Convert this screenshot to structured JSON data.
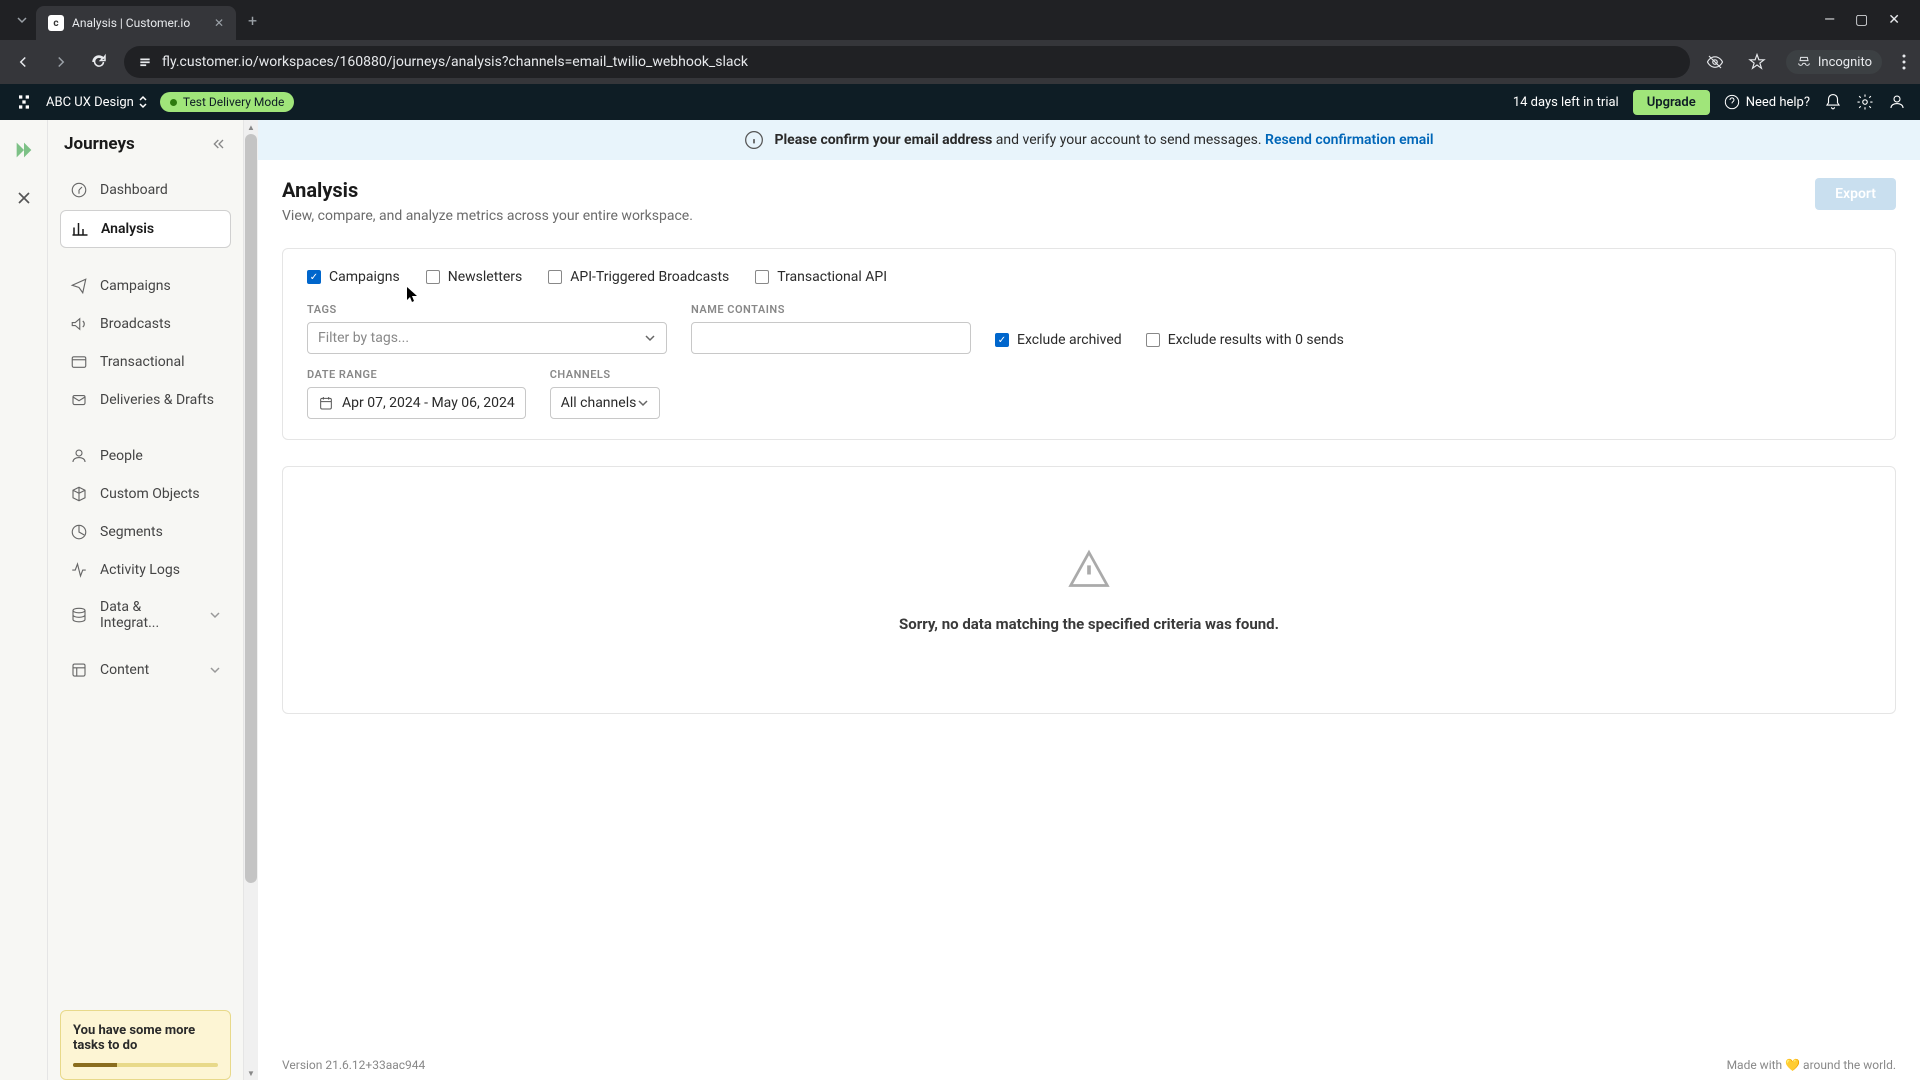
{
  "browser": {
    "tab_title": "Analysis | Customer.io",
    "url": "fly.customer.io/workspaces/160880/journeys/analysis?channels=email_twilio_webhook_slack",
    "incognito": "Incognito"
  },
  "header": {
    "workspace": "ABC UX Design",
    "delivery_mode": "Test Delivery Mode",
    "trial": "14 days left in trial",
    "upgrade": "Upgrade",
    "help": "Need help?"
  },
  "sidebar": {
    "title": "Journeys",
    "items": {
      "dashboard": "Dashboard",
      "analysis": "Analysis",
      "campaigns": "Campaigns",
      "broadcasts": "Broadcasts",
      "transactional": "Transactional",
      "deliveries": "Deliveries & Drafts",
      "people": "People",
      "custom_objects": "Custom Objects",
      "segments": "Segments",
      "activity_logs": "Activity Logs",
      "data_integrations": "Data & Integrat...",
      "content": "Content"
    },
    "tasks_title": "You have some more tasks to do"
  },
  "banner": {
    "strong": "Please confirm your email address",
    "rest": " and verify your account to send messages. ",
    "link": "Resend confirmation email"
  },
  "page": {
    "title": "Analysis",
    "subtitle": "View, compare, and analyze metrics across your entire workspace.",
    "export": "Export"
  },
  "filters": {
    "types": {
      "campaigns": "Campaigns",
      "newsletters": "Newsletters",
      "api_broadcasts": "API-Triggered Broadcasts",
      "transactional": "Transactional API"
    },
    "labels": {
      "tags": "TAGS",
      "name_contains": "NAME CONTAINS",
      "date_range": "DATE RANGE",
      "channels": "CHANNELS"
    },
    "tags_placeholder": "Filter by tags...",
    "exclude_archived": "Exclude archived",
    "exclude_zero_sends": "Exclude results with 0 sends",
    "date_range_value": "Apr 07, 2024 - May 06, 2024",
    "channels_value": "All channels"
  },
  "empty": {
    "message": "Sorry, no data matching the specified criteria was found."
  },
  "footer": {
    "version": "Version 21.6.12+33aac944",
    "made_with": "Made with 💛 around the world."
  }
}
